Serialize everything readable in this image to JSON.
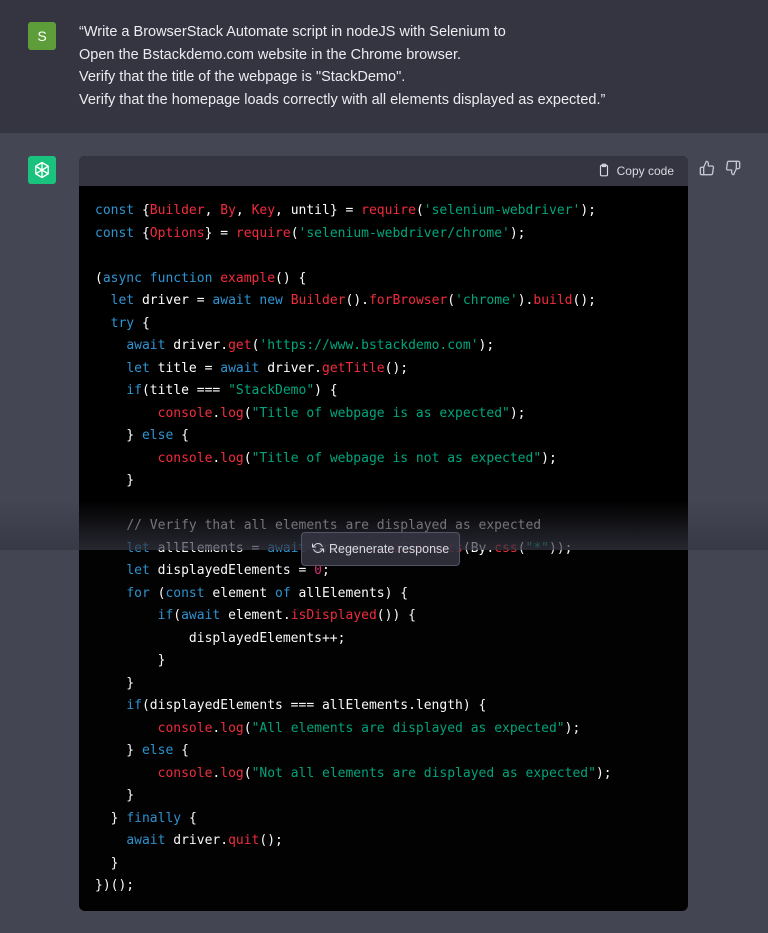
{
  "user": {
    "avatar_letter": "S",
    "prompt_lines": [
      "“Write a BrowserStack Automate script in nodeJS with Selenium to",
      "Open the Bstackdemo.com website in the Chrome browser.",
      "Verify that the title of the webpage is \"StackDemo\".",
      "Verify that the homepage loads correctly with all elements displayed as expected.”"
    ]
  },
  "assistant": {
    "avatar_icon": "openai-logo-icon",
    "copy_label": "Copy code",
    "code_language": "javascript"
  },
  "regenerate_label": "Regenerate response",
  "code_lines": [
    [
      [
        "k",
        "const "
      ],
      [
        "",
        "{"
      ],
      [
        "f",
        "Builder"
      ],
      [
        "",
        ", "
      ],
      [
        "f",
        "By"
      ],
      [
        "",
        ", "
      ],
      [
        "f",
        "Key"
      ],
      [
        "",
        ", until} = "
      ],
      [
        "f",
        "require"
      ],
      [
        "",
        "("
      ],
      [
        "s",
        "'selenium-webdriver'"
      ],
      [
        "",
        ");"
      ]
    ],
    [
      [
        "k",
        "const "
      ],
      [
        "",
        "{"
      ],
      [
        "f",
        "Options"
      ],
      [
        "",
        "} = "
      ],
      [
        "f",
        "require"
      ],
      [
        "",
        "("
      ],
      [
        "s",
        "'selenium-webdriver/chrome'"
      ],
      [
        "",
        ");"
      ]
    ],
    [
      [
        "",
        ""
      ]
    ],
    [
      [
        "",
        "("
      ],
      [
        "k",
        "async function "
      ],
      [
        "f",
        "example"
      ],
      [
        "",
        "() {"
      ]
    ],
    [
      [
        "",
        "  "
      ],
      [
        "k",
        "let "
      ],
      [
        "",
        "driver = "
      ],
      [
        "k",
        "await new "
      ],
      [
        "f",
        "Builder"
      ],
      [
        "",
        "()."
      ],
      [
        "f",
        "forBrowser"
      ],
      [
        "",
        "("
      ],
      [
        "s",
        "'chrome'"
      ],
      [
        "",
        ")."
      ],
      [
        "f",
        "build"
      ],
      [
        "",
        "();"
      ]
    ],
    [
      [
        "",
        "  "
      ],
      [
        "k",
        "try "
      ],
      [
        "",
        "{"
      ]
    ],
    [
      [
        "",
        "    "
      ],
      [
        "k",
        "await "
      ],
      [
        "",
        "driver."
      ],
      [
        "f",
        "get"
      ],
      [
        "",
        "("
      ],
      [
        "s",
        "'https://www.bstackdemo.com'"
      ],
      [
        "",
        ");"
      ]
    ],
    [
      [
        "",
        "    "
      ],
      [
        "k",
        "let "
      ],
      [
        "",
        "title = "
      ],
      [
        "k",
        "await "
      ],
      [
        "",
        "driver."
      ],
      [
        "f",
        "getTitle"
      ],
      [
        "",
        "();"
      ]
    ],
    [
      [
        "",
        "    "
      ],
      [
        "k",
        "if"
      ],
      [
        "",
        "(title === "
      ],
      [
        "s",
        "\"StackDemo\""
      ],
      [
        "",
        ") {"
      ]
    ],
    [
      [
        "",
        "        "
      ],
      [
        "f",
        "console"
      ],
      [
        "",
        "."
      ],
      [
        "f",
        "log"
      ],
      [
        "",
        "("
      ],
      [
        "s",
        "\"Title of webpage is as expected\""
      ],
      [
        "",
        ");"
      ]
    ],
    [
      [
        "",
        "    } "
      ],
      [
        "k",
        "else "
      ],
      [
        "",
        "{"
      ]
    ],
    [
      [
        "",
        "        "
      ],
      [
        "f",
        "console"
      ],
      [
        "",
        "."
      ],
      [
        "f",
        "log"
      ],
      [
        "",
        "("
      ],
      [
        "s",
        "\"Title of webpage is not as expected\""
      ],
      [
        "",
        ");"
      ]
    ],
    [
      [
        "",
        "    }"
      ]
    ],
    [
      [
        "",
        ""
      ]
    ],
    [
      [
        "",
        "    "
      ],
      [
        "c",
        "// Verify that all elements are displayed as expected"
      ]
    ],
    [
      [
        "",
        "    "
      ],
      [
        "k",
        "let "
      ],
      [
        "",
        "allElements = "
      ],
      [
        "k",
        "await "
      ],
      [
        "",
        "driver."
      ],
      [
        "f",
        "findElements"
      ],
      [
        "",
        "(By."
      ],
      [
        "f",
        "css"
      ],
      [
        "",
        "("
      ],
      [
        "s",
        "\"*\""
      ],
      [
        "",
        "));"
      ]
    ],
    [
      [
        "",
        "    "
      ],
      [
        "k",
        "let "
      ],
      [
        "",
        "displayedElements = "
      ],
      [
        "n",
        "0"
      ],
      [
        "",
        ";"
      ]
    ],
    [
      [
        "",
        "    "
      ],
      [
        "k",
        "for "
      ],
      [
        "",
        "("
      ],
      [
        "k",
        "const "
      ],
      [
        "",
        "element "
      ],
      [
        "k",
        "of "
      ],
      [
        "",
        "allElements) {"
      ]
    ],
    [
      [
        "",
        "        "
      ],
      [
        "k",
        "if"
      ],
      [
        "",
        "("
      ],
      [
        "k",
        "await "
      ],
      [
        "",
        "element."
      ],
      [
        "f",
        "isDisplayed"
      ],
      [
        "",
        "()) {"
      ]
    ],
    [
      [
        "",
        "            displayedElements++;"
      ]
    ],
    [
      [
        "",
        "        }"
      ]
    ],
    [
      [
        "",
        "    }"
      ]
    ],
    [
      [
        "",
        "    "
      ],
      [
        "k",
        "if"
      ],
      [
        "",
        "(displayedElements === allElements.length) {"
      ]
    ],
    [
      [
        "",
        "        "
      ],
      [
        "f",
        "console"
      ],
      [
        "",
        "."
      ],
      [
        "f",
        "log"
      ],
      [
        "",
        "("
      ],
      [
        "s",
        "\"All elements are displayed as expected\""
      ],
      [
        "",
        ");"
      ]
    ],
    [
      [
        "",
        "    } "
      ],
      [
        "k",
        "else "
      ],
      [
        "",
        "{"
      ]
    ],
    [
      [
        "",
        "        "
      ],
      [
        "f",
        "console"
      ],
      [
        "",
        "."
      ],
      [
        "f",
        "log"
      ],
      [
        "",
        "("
      ],
      [
        "s",
        "\"Not all elements are displayed as expected\""
      ],
      [
        "",
        ");"
      ]
    ],
    [
      [
        "",
        "    }"
      ]
    ],
    [
      [
        "",
        "  } "
      ],
      [
        "k",
        "finally "
      ],
      [
        "",
        "{"
      ]
    ],
    [
      [
        "",
        "    "
      ],
      [
        "k",
        "await "
      ],
      [
        "",
        "driver."
      ],
      [
        "f",
        "quit"
      ],
      [
        "",
        "();"
      ]
    ],
    [
      [
        "",
        "  }"
      ]
    ],
    [
      [
        "",
        "})();"
      ]
    ]
  ]
}
